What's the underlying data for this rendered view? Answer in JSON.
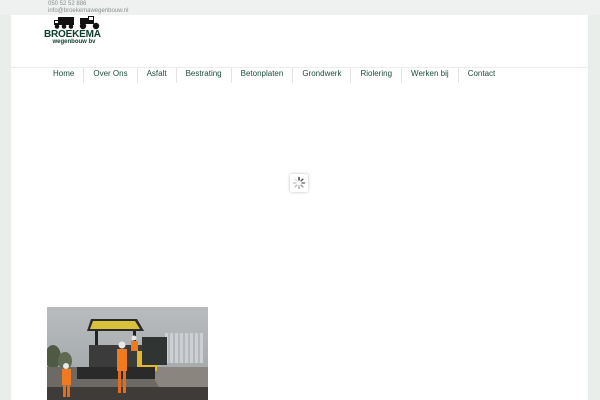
{
  "topbar": {
    "phone": "050 52 52 886",
    "email": "info@broekemawegenbouw.nl"
  },
  "logo": {
    "name": "BROEKEMA",
    "tagline": "wegenbouw bv",
    "icon": "truck-and-roller-logo-icon"
  },
  "nav": {
    "items": [
      "Home",
      "Over Ons",
      "Asfalt",
      "Bestrating",
      "Betonplaten",
      "Grondwerk",
      "Riolering",
      "Werken bij",
      "Contact"
    ]
  },
  "loader": {
    "icon": "loading-spinner-icon"
  },
  "photo": {
    "subject": "asphalt paving crew at work"
  },
  "colors": {
    "brand": "#0e3d2b",
    "nav_text": "#1d4d3a",
    "background": "#e9eeeb"
  }
}
